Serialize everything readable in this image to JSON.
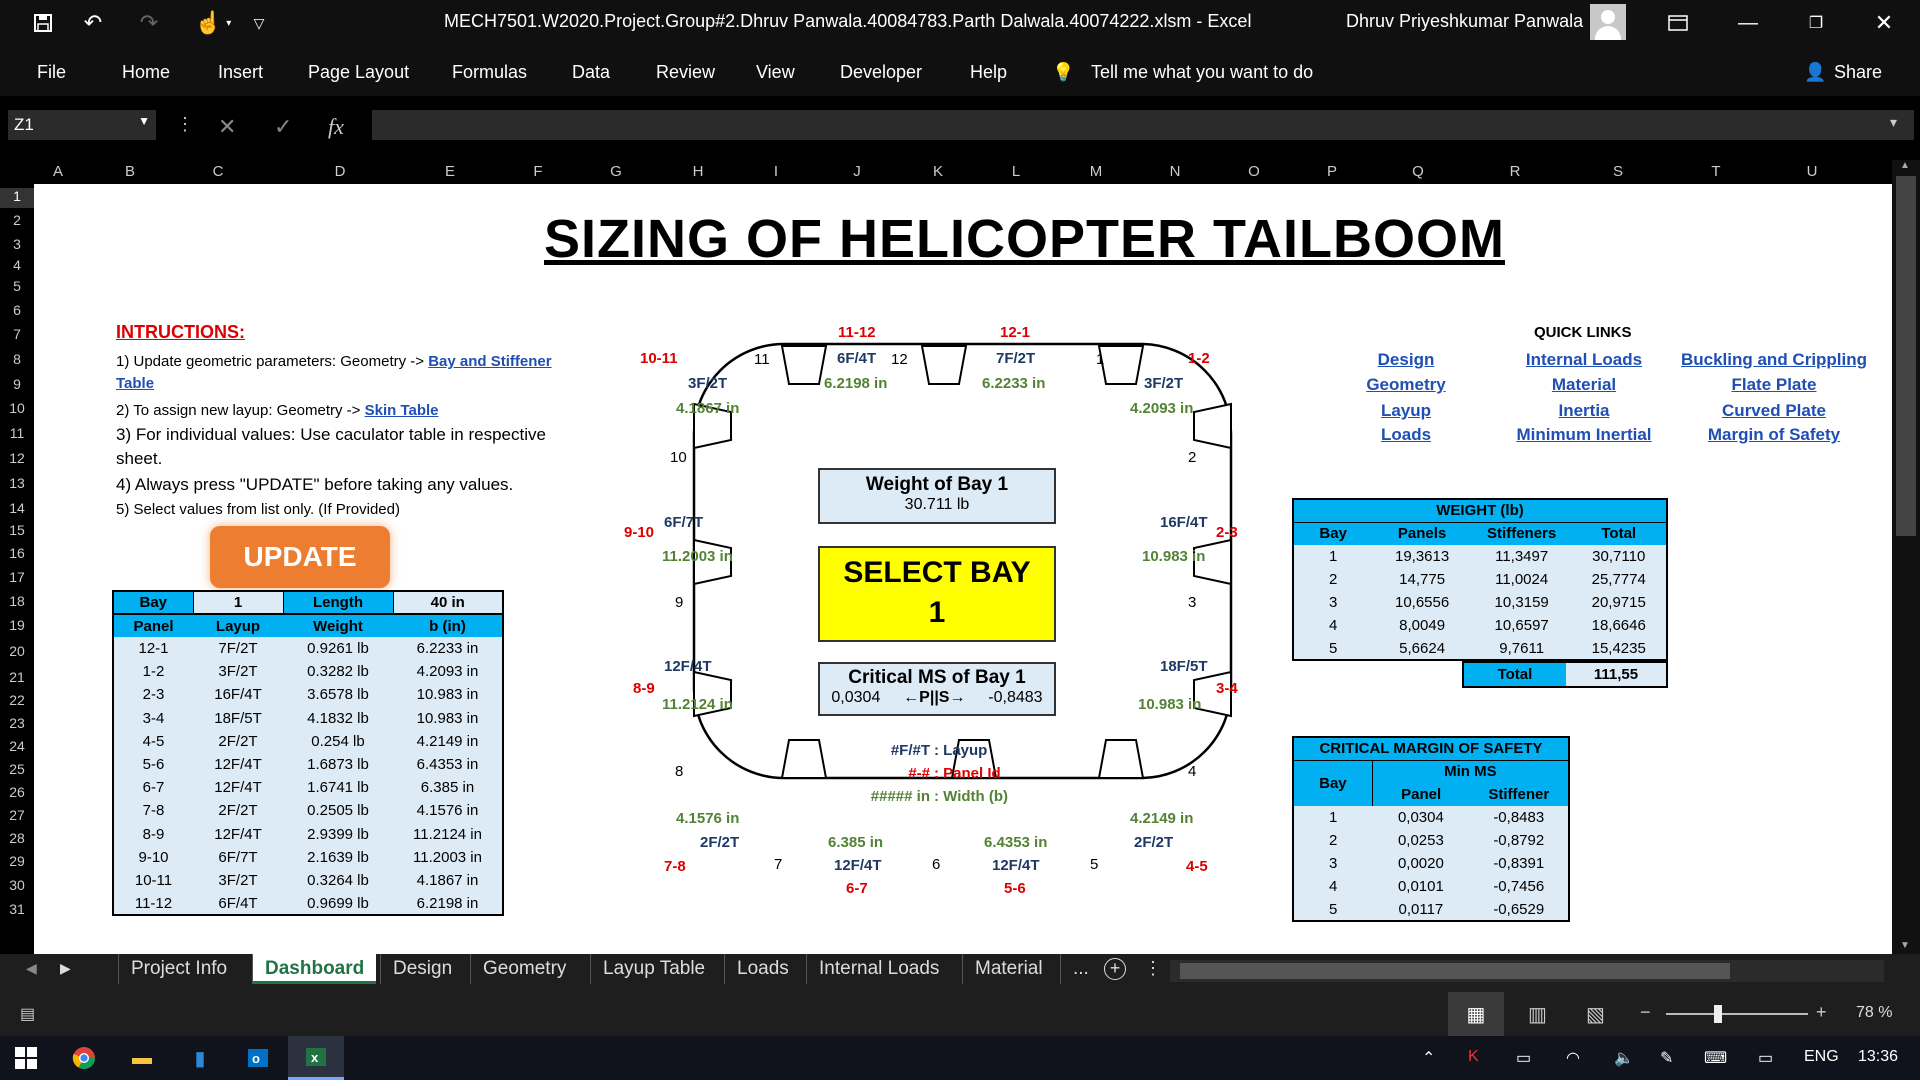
{
  "window": {
    "doc_title": "MECH7501.W2020.Project.Group#2.Dhruv Panwala.40084783.Parth Dalwala.40074222.xlsm  -  Excel",
    "user_name": "Dhruv Priyeshkumar Panwala"
  },
  "ribbon": {
    "tabs": [
      "File",
      "Home",
      "Insert",
      "Page Layout",
      "Formulas",
      "Data",
      "Review",
      "View",
      "Developer",
      "Help"
    ],
    "tell_me": "Tell me what you want to do",
    "share": "Share"
  },
  "formula_bar": {
    "name_box": "Z1",
    "fx": "fx"
  },
  "columns": [
    "A",
    "B",
    "C",
    "D",
    "E",
    "F",
    "G",
    "H",
    "I",
    "J",
    "K",
    "L",
    "M",
    "N",
    "O",
    "P",
    "Q",
    "R",
    "S",
    "T",
    "U"
  ],
  "rows": [
    "1",
    "2",
    "3",
    "4",
    "5",
    "6",
    "7",
    "8",
    "9",
    "10",
    "11",
    "12",
    "13",
    "14",
    "15",
    "16",
    "17",
    "18",
    "19",
    "20",
    "21",
    "22",
    "23",
    "24",
    "25",
    "26",
    "27",
    "28",
    "29",
    "30",
    "31"
  ],
  "sheet": {
    "title": "SIZING OF HELICOPTER TAILBOOM",
    "instructions_heading": "INTRUCTIONS:",
    "instr1_text": "1) Update geometric parameters: Geometry -> ",
    "instr1_link": "Bay and Stiffener",
    "instr1_link2": "Table",
    "instr2_text": "2) To assign new layup: Geometry -> ",
    "instr2_link": "Skin Table",
    "instr3a": "3) For individual values: Use caculator table in respective",
    "instr3b": "sheet.",
    "instr4": "4) Always press \"UPDATE\" before taking any values.",
    "instr5": "5) Select values from list only. (If Provided)",
    "update_button": "UPDATE",
    "bay_table": {
      "bay_label": "Bay",
      "bay_value": "1",
      "length_label": "Length",
      "length_value": "40 in",
      "headers": [
        "Panel",
        "Layup",
        "Weight",
        "b (in)"
      ],
      "rows": [
        [
          "12-1",
          "7F/2T",
          "0.9261 lb",
          "6.2233 in"
        ],
        [
          "1-2",
          "3F/2T",
          "0.3282 lb",
          "4.2093 in"
        ],
        [
          "2-3",
          "16F/4T",
          "3.6578 lb",
          "10.983 in"
        ],
        [
          "3-4",
          "18F/5T",
          "4.1832 lb",
          "10.983 in"
        ],
        [
          "4-5",
          "2F/2T",
          "0.254 lb",
          "4.2149 in"
        ],
        [
          "5-6",
          "12F/4T",
          "1.6873 lb",
          "6.4353 in"
        ],
        [
          "6-7",
          "12F/4T",
          "1.6741 lb",
          "6.385 in"
        ],
        [
          "7-8",
          "2F/2T",
          "0.2505 lb",
          "4.1576 in"
        ],
        [
          "8-9",
          "12F/4T",
          "2.9399 lb",
          "11.2124 in"
        ],
        [
          "9-10",
          "6F/7T",
          "2.1639 lb",
          "11.2003 in"
        ],
        [
          "10-11",
          "3F/2T",
          "0.3264 lb",
          "4.1867 in"
        ],
        [
          "11-12",
          "6F/4T",
          "0.9699 lb",
          "6.2198 in"
        ]
      ]
    },
    "diagram": {
      "stiffeners": [
        "1",
        "2",
        "3",
        "4",
        "5",
        "6",
        "7",
        "8",
        "9",
        "10",
        "11",
        "12"
      ],
      "panel_ids": {
        "p11_12": "11-12",
        "p12_1": "12-1",
        "p10_11": "10-11",
        "p1_2": "1-2",
        "p9_10": "9-10",
        "p2_3": "2-3",
        "p8_9": "8-9",
        "p3_4": "3-4",
        "p7_8": "7-8",
        "p4_5": "4-5",
        "p6_7": "6-7",
        "p5_6": "5-6"
      },
      "layups": {
        "l11_12": "6F/4T",
        "l12_1": "7F/2T",
        "l10_11": "3F/2T",
        "l1_2": "3F/2T",
        "l9_10": "6F/7T",
        "l2_3": "16F/4T",
        "l8_9": "12F/4T",
        "l3_4": "18F/5T",
        "l7_8": "2F/2T",
        "l4_5": "2F/2T",
        "l6_7": "12F/4T",
        "l5_6": "12F/4T"
      },
      "widths": {
        "w11_12": "6.2198 in",
        "w12_1": "6.2233 in",
        "w10_11": "4.1867 in",
        "w1_2": "4.2093 in",
        "w9_10": "11.2003 in",
        "w2_3": "10.983 in",
        "w8_9": "11.2124 in",
        "w3_4": "10.983 in",
        "w7_8": "4.1576 in",
        "w4_5": "4.2149 in",
        "w6_7": "6.385 in",
        "w5_6": "6.4353 in"
      },
      "weight_title": "Weight of Bay 1",
      "weight_value": "30.711 lb",
      "select_bay_label": "SELECT BAY",
      "select_bay_value": "1",
      "ms_title": "Critical MS of Bay 1",
      "ms_panel": "0,0304",
      "ms_arrow": "←P||S→",
      "ms_stiffener": "-0,8483",
      "legend1_key": "#F/#T",
      "legend1_val": ": Layup",
      "legend2_key": "#-#",
      "legend2_val": ": Panel Id",
      "legend3_key": "##### in",
      "legend3_val": ": Width (b)"
    },
    "quick_links": {
      "title": "QUICK LINKS",
      "col1": [
        "Design",
        "Geometry",
        "Layup",
        "Loads"
      ],
      "col2": [
        "Internal Loads",
        "Material",
        "Inertia",
        "Minimum Inertial"
      ],
      "col3": [
        "Buckling and Crippling",
        "Flate Plate",
        "Curved Plate",
        "Margin of Safety"
      ]
    },
    "weight_table": {
      "title": "WEIGHT (lb)",
      "headers": [
        "Bay",
        "Panels",
        "Stiffeners",
        "Total"
      ],
      "rows": [
        [
          "1",
          "19,3613",
          "11,3497",
          "30,7110"
        ],
        [
          "2",
          "14,775",
          "11,0024",
          "25,7774"
        ],
        [
          "3",
          "10,6556",
          "10,3159",
          "20,9715"
        ],
        [
          "4",
          "8,0049",
          "10,6597",
          "18,6646"
        ],
        [
          "5",
          "5,6624",
          "9,7611",
          "15,4235"
        ]
      ],
      "total_label": "Total",
      "total_value": "111,55"
    },
    "ms_table": {
      "title": "CRITICAL MARGIN OF SAFETY",
      "bay_label": "Bay",
      "min_ms": "Min MS",
      "panel": "Panel",
      "stiffener": "Stiffener",
      "rows": [
        [
          "1",
          "0,0304",
          "-0,8483"
        ],
        [
          "2",
          "0,0253",
          "-0,8792"
        ],
        [
          "3",
          "0,0020",
          "-0,8391"
        ],
        [
          "4",
          "0,0101",
          "-0,7456"
        ],
        [
          "5",
          "0,0117",
          "-0,6529"
        ]
      ]
    }
  },
  "sheet_tabs": [
    "Project Info",
    "Dashboard",
    "Design",
    "Geometry",
    "Layup Table",
    "Loads",
    "Internal Loads",
    "Material"
  ],
  "sheet_tabs_more": "...",
  "status": {
    "zoom": "78 %"
  },
  "taskbar": {
    "language": "ENG",
    "time": "13:36"
  },
  "colors": {
    "header_blue": "#00b0f0",
    "light_blue": "#ddebf7",
    "select_yellow": "#ffff00",
    "update_orange": "#ed7d31",
    "excel_green": "#217346"
  }
}
